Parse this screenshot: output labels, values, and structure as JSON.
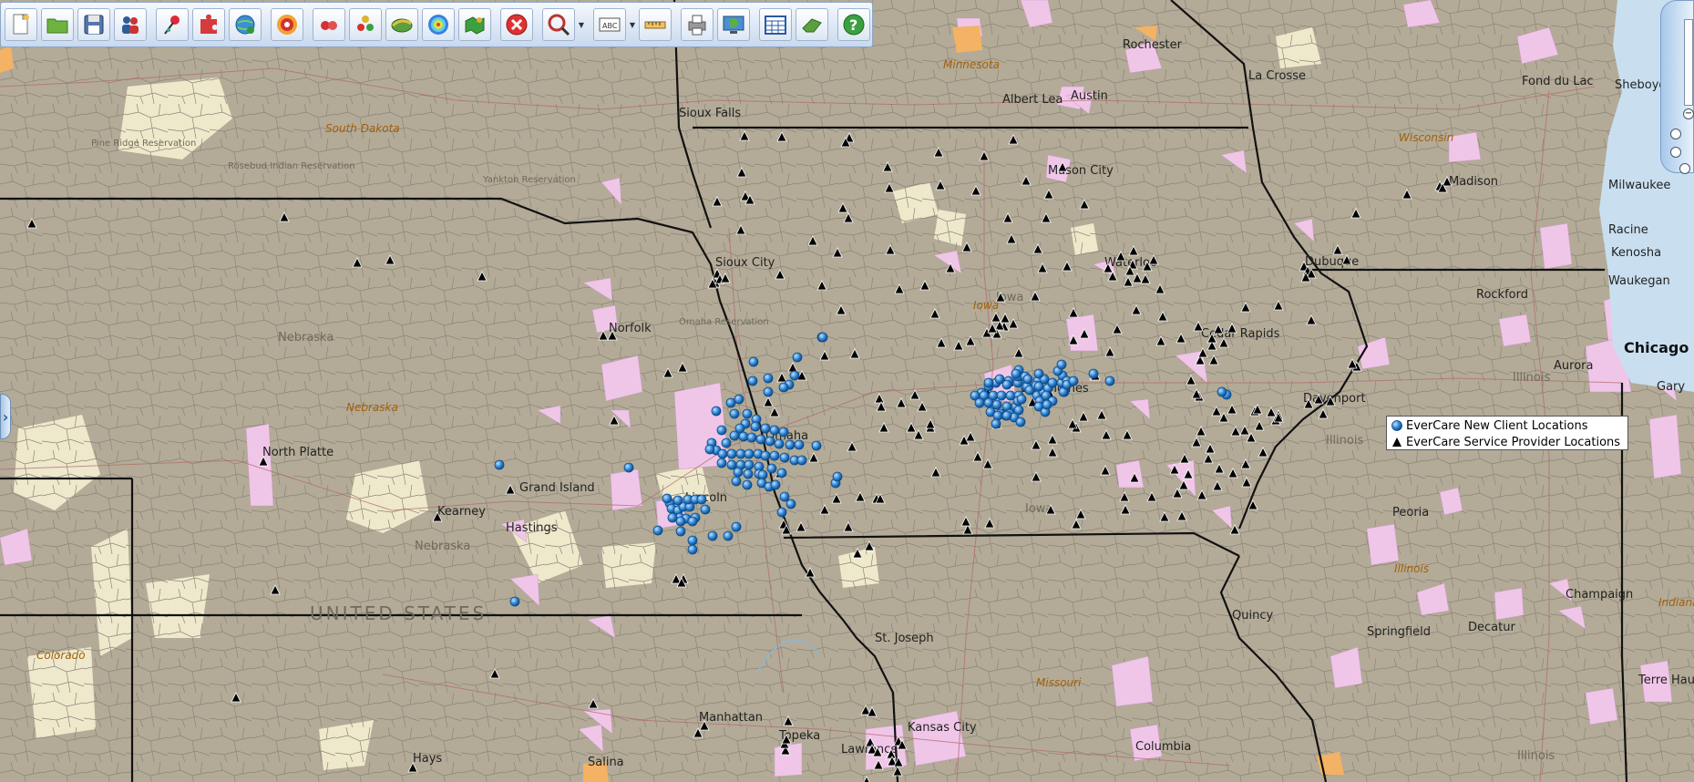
{
  "toolbar": {
    "buttons": [
      {
        "name": "new-map-button",
        "icon": "new-document-icon"
      },
      {
        "name": "open-map-button",
        "icon": "folder-icon"
      },
      {
        "name": "save-map-button",
        "icon": "floppy-disk-icon"
      },
      {
        "name": "users-button",
        "icon": "people-icon"
      },
      {
        "name": "add-pin-button",
        "icon": "pushpin-icon"
      },
      {
        "name": "import-data-button",
        "icon": "puzzle-icon"
      },
      {
        "name": "globe-data-button",
        "icon": "globe-plus-icon"
      },
      {
        "name": "radius-button",
        "icon": "target-icon"
      },
      {
        "name": "heat-map-button",
        "icon": "red-dots-icon"
      },
      {
        "name": "cluster-button",
        "icon": "color-dots-icon"
      },
      {
        "name": "territory-button",
        "icon": "layers-icon"
      },
      {
        "name": "drive-time-button",
        "icon": "rings-icon"
      },
      {
        "name": "territory-tools-button",
        "icon": "puzzle-map-icon"
      },
      {
        "name": "delete-button",
        "icon": "close-circle-icon"
      },
      {
        "name": "search-button",
        "icon": "search-circle-icon"
      },
      {
        "name": "label-button",
        "icon": "text-label-icon"
      },
      {
        "name": "measure-button",
        "icon": "ruler-icon"
      },
      {
        "name": "print-button",
        "icon": "printer-icon"
      },
      {
        "name": "web-map-button",
        "icon": "globe-monitor-icon"
      },
      {
        "name": "calculator-button",
        "icon": "calculator-icon"
      },
      {
        "name": "eraser-button",
        "icon": "eraser-icon"
      },
      {
        "name": "help-button",
        "icon": "question-mark-icon"
      }
    ]
  },
  "colors": {
    "land": "#b3ab97",
    "county_line": "#8b8478",
    "state_line": "#111111",
    "urban": "#f0c6e8",
    "open_land": "#f5f0d2",
    "client_marker": "#2f84d2",
    "provider_marker": "#000000",
    "water": "#c9dff0"
  },
  "legend": {
    "client_label": "EverCare New Client Locations",
    "provider_label": "EverCare Service Provider Locations"
  },
  "map_labels": {
    "states": [
      "Minnesota",
      "South Dakota",
      "Nebraska",
      "Iowa",
      "Wisconsin",
      "Illinois",
      "Missouri",
      "Colorado",
      "Indiana"
    ],
    "country": "UNITED STATES",
    "cities": [
      "Sioux Falls",
      "Sioux City",
      "Norfolk",
      "Omaha",
      "Lincoln",
      "Grand Island",
      "Kearney",
      "Hastings",
      "North Platte",
      "Des Moines",
      "Waterloo",
      "Mason City",
      "Cedar Rapids",
      "Davenport",
      "Dubuque",
      "Rochester",
      "Albert Lea",
      "Austin",
      "La Crosse",
      "Madison",
      "Milwaukee",
      "Racine",
      "Kenosha",
      "Waukegan",
      "Rockford",
      "Chicago",
      "Aurora",
      "Peoria",
      "Springfield",
      "Decatur",
      "Champaign",
      "Quincy",
      "St. Joseph",
      "Kansas City",
      "Lawrence",
      "Topeka",
      "Manhattan",
      "Salina",
      "Hays",
      "Columbia",
      "Fond du Lac",
      "Sheboygan",
      "Terre Haute"
    ],
    "reservations": [
      "Pine Ridge Reservation",
      "Rosebud Indian Reservation",
      "Yankton Reservation",
      "Omaha Reservation"
    ],
    "extra": [
      "Nebraska",
      "Iowa",
      "Iowa",
      "Illinois",
      "Illinois",
      "Illinois",
      "Nebraska",
      "Gary"
    ]
  }
}
